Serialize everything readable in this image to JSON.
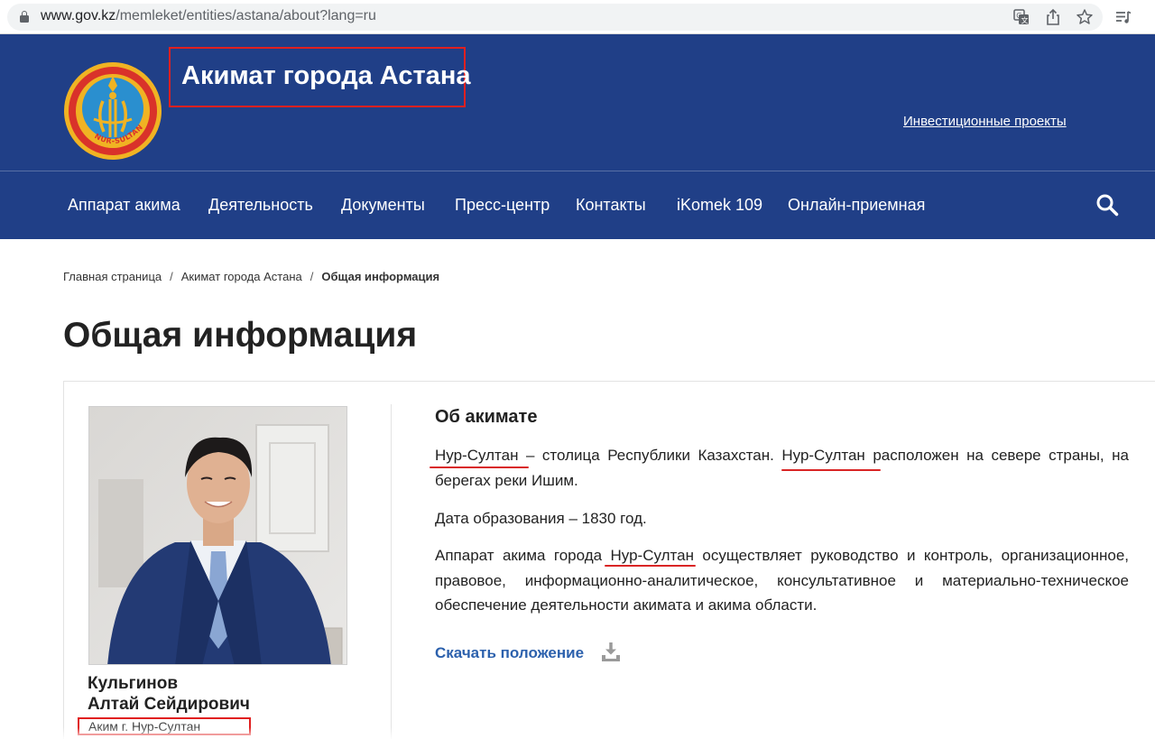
{
  "browser": {
    "url_domain": "www.gov.kz",
    "url_path": "/memleket/entities/astana/about?lang=ru",
    "icons": [
      "lock-icon",
      "translate-icon",
      "share-icon",
      "star-icon",
      "reading-list-icon"
    ]
  },
  "header": {
    "title": "Акимат города Астана",
    "invest_link": "Инвестиционные проекты",
    "emblem_text": "NUR-SULTAN",
    "background_color": "#203f87"
  },
  "nav": {
    "items": [
      "Аппарат акима",
      "Деятельность",
      "Документы",
      "Пресс-центр",
      "Контакты",
      "iKomek 109",
      "Онлайн-приемная"
    ],
    "search_icon": "search-icon"
  },
  "breadcrumb": {
    "items": [
      "Главная страница",
      "Акимат города Астана",
      "Общая информация"
    ],
    "separator": "/"
  },
  "page": {
    "title": "Общая информация"
  },
  "person": {
    "last_name": "Кульгинов",
    "first_names": "Алтай Сейдирович",
    "position": "Аким г. Нур-Султан"
  },
  "about": {
    "title": "Об акимате",
    "p1_a": "Нур-Султан",
    "p1_b": " – столица Республики Казахстан. ",
    "p1_c": "Нур-Султан",
    "p1_d": " расположен на севере страны, на берегах реки Ишим.",
    "p2": "Дата образования – 1830 год.",
    "p3_a": "Аппарат акима города ",
    "p3_b": "Нур-Султан",
    "p3_c": " осуществляет руководство и контроль, организационное, правовое, информационно-аналитическое, консультативное и материально-техническое обеспечение деятельности акимата и акима области.",
    "download_label": "Скачать положение"
  },
  "colors": {
    "accent_link": "#2c61ad",
    "annotation_red": "#e02020"
  }
}
